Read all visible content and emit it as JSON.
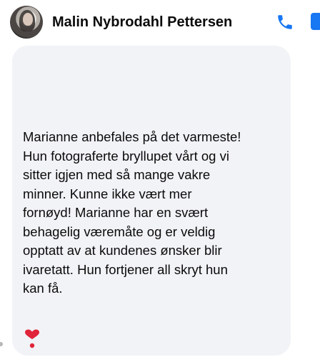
{
  "header": {
    "contact_name": "Malin Nybrodahl Pettersen"
  },
  "message": {
    "text": "Marianne anbefales på det varmeste!\nHun fotograferte bryllupet vårt og vi\nsitter igjen med så mange vakre\nminner. Kunne ikke vært mer\nfornøyd! Marianne har en svært\nbehagelig væremåte og er veldig\nopptatt av at kundenes ønsker blir\nivaretatt. Hun fortjener all skryt hun\nkan få."
  },
  "colors": {
    "accent": "#1877f2",
    "bubble": "#f2f3f7",
    "reaction_heart": "#e0243a"
  },
  "icons": {
    "call": "phone-icon",
    "video": "video-camera-icon",
    "reaction": "heavy-heart-exclamation-icon"
  }
}
